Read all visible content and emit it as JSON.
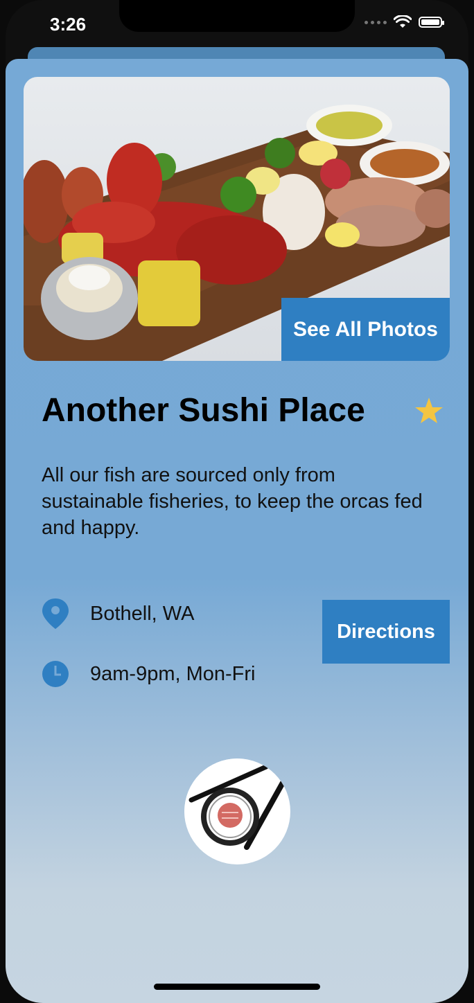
{
  "status_bar": {
    "time": "3:26"
  },
  "card": {
    "see_all_photos_label": "See All Photos",
    "title": "Another Sushi Place",
    "favorite_icon": "star-icon",
    "description": "All our fish are sourced only from sustainable fisheries, to keep the orcas fed and happy.",
    "location": {
      "icon": "location-pin-icon",
      "text": "Bothell, WA"
    },
    "hours": {
      "icon": "clock-icon",
      "text": "9am-9pm, Mon-Fri"
    },
    "directions_label": "Directions",
    "logo_icon": "sushi-chopsticks-logo"
  },
  "colors": {
    "accent_button": "#2f7fc2",
    "star": "#f4c542",
    "card_top": "#76a9d6",
    "card_bottom": "#c6d5e1"
  }
}
